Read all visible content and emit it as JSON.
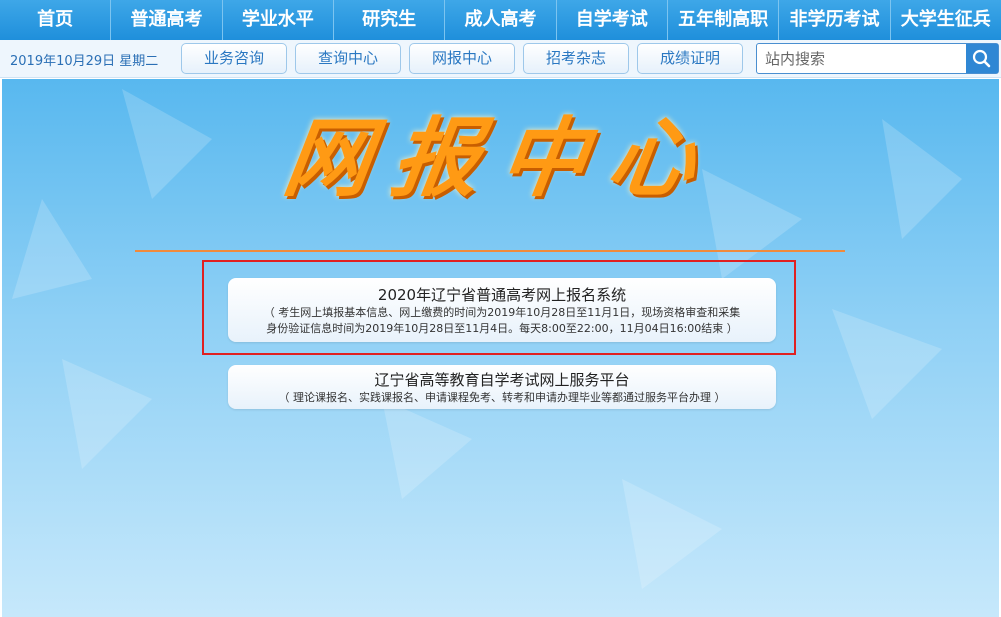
{
  "topnav": {
    "items": [
      "首页",
      "普通高考",
      "学业水平",
      "研究生",
      "成人高考",
      "自学考试",
      "五年制高职",
      "非学历考试",
      "大学生征兵"
    ]
  },
  "subbar": {
    "date": "2019年10月29日 星期二",
    "buttons": [
      "业务咨询",
      "查询中心",
      "网报中心",
      "招考杂志",
      "成绩证明"
    ],
    "search_placeholder": "站内搜索"
  },
  "main": {
    "banner_title": "网报中心",
    "cards": [
      {
        "title": "2020年辽宁省普通高考网上报名系统",
        "desc_line1": "（ 考生网上填报基本信息、网上缴费的时间为2019年10月28日至11月1日，现场资格审查和采集",
        "desc_line2": "身份验证信息时间为2019年10月28日至11月4日。每天8:00至22:00，11月04日16:00结束 ）"
      },
      {
        "title": "辽宁省高等教育自学考试网上服务平台",
        "desc_line1": "（ 理论课报名、实践课报名、申请课程免考、转考和申请办理毕业等都通过服务平台办理 ）"
      }
    ]
  },
  "colors": {
    "nav_bg": "#1f8fdb",
    "accent_orange": "#ff9a14",
    "highlight_red": "#e02020"
  }
}
